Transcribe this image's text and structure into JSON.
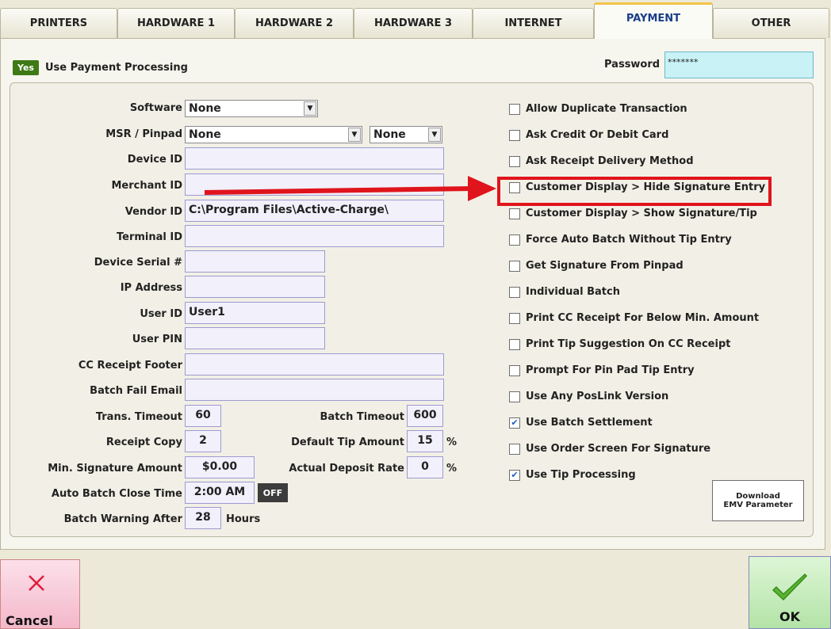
{
  "tabs": [
    "PRINTERS",
    "HARDWARE 1",
    "HARDWARE 2",
    "HARDWARE 3",
    "INTERNET",
    "PAYMENT",
    "OTHER"
  ],
  "use_payment": {
    "badge": "Yes",
    "label": "Use Payment Processing"
  },
  "password": {
    "label": "Password",
    "value": "*******"
  },
  "fields": {
    "software_label": "Software",
    "software_value": "None",
    "msr_label": "MSR / Pinpad",
    "msr_value": "None",
    "msr_value2": "None",
    "device_id_label": "Device ID",
    "device_id": "",
    "merchant_id_label": "Merchant ID",
    "merchant_id": "",
    "vendor_id_label": "Vendor ID",
    "vendor_id": "C:\\Program Files\\Active-Charge\\",
    "terminal_id_label": "Terminal ID",
    "terminal_id": "",
    "device_serial_label": "Device Serial #",
    "device_serial": "",
    "ip_label": "IP Address",
    "ip": "",
    "user_id_label": "User ID",
    "user_id": "User1",
    "user_pin_label": "User PIN",
    "user_pin": "",
    "cc_footer_label": "CC Receipt Footer",
    "cc_footer": "",
    "batch_fail_label": "Batch Fail Email",
    "batch_fail": "",
    "trans_timeout_label": "Trans. Timeout",
    "trans_timeout": "60",
    "batch_timeout_label": "Batch Timeout",
    "batch_timeout": "600",
    "receipt_copy_label": "Receipt Copy",
    "receipt_copy": "2",
    "default_tip_label": "Default Tip Amount",
    "default_tip": "15",
    "default_tip_unit": "%",
    "min_sig_label": "Min. Signature Amount",
    "min_sig": "$0.00",
    "deposit_rate_label": "Actual Deposit Rate",
    "deposit_rate": "0",
    "deposit_rate_unit": "%",
    "auto_batch_label": "Auto Batch Close Time",
    "auto_batch": "2:00 AM",
    "auto_batch_toggle": "OFF",
    "batch_warning_label": "Batch Warning After",
    "batch_warning": "28",
    "batch_warning_unit": "Hours"
  },
  "options": [
    {
      "label": "Allow Duplicate Transaction",
      "checked": false
    },
    {
      "label": "Ask Credit Or Debit Card",
      "checked": false
    },
    {
      "label": "Ask Receipt Delivery Method",
      "checked": false
    },
    {
      "label": "Customer Display > Hide Signature Entry",
      "checked": false
    },
    {
      "label": "Customer Display > Show Signature/Tip",
      "checked": false
    },
    {
      "label": "Force Auto Batch Without Tip Entry",
      "checked": false
    },
    {
      "label": "Get Signature From Pinpad",
      "checked": false
    },
    {
      "label": "Individual Batch",
      "checked": false
    },
    {
      "label": "Print CC Receipt For Below Min. Amount",
      "checked": false
    },
    {
      "label": "Print Tip Suggestion On CC Receipt",
      "checked": false
    },
    {
      "label": "Prompt For Pin Pad Tip Entry",
      "checked": false
    },
    {
      "label": "Use Any PosLink Version",
      "checked": false
    },
    {
      "label": "Use Batch Settlement",
      "checked": true
    },
    {
      "label": "Use Order Screen For Signature",
      "checked": false
    },
    {
      "label": "Use Tip Processing",
      "checked": true
    }
  ],
  "download_button": {
    "line1": "Download",
    "line2": "EMV Parameter"
  },
  "cancel_label": "Cancel",
  "ok_label": "OK",
  "colors": {
    "highlight": "#e0141c",
    "active_tab": "#1a3e8a"
  }
}
